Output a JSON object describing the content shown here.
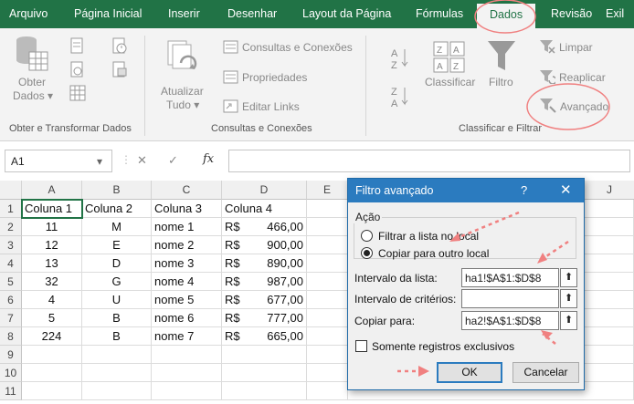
{
  "ribbon_tabs": [
    "Arquivo",
    "Página Inicial",
    "Inserir",
    "Desenhar",
    "Layout da Página",
    "Fórmulas",
    "Dados",
    "Revisão",
    "Exil"
  ],
  "active_tab": "Dados",
  "groups": {
    "obter": {
      "label": "Obter e Transformar Dados",
      "obter_btn_line1": "Obter",
      "obter_btn_line2": "Dados"
    },
    "consultas": {
      "label": "Consultas e Conexões",
      "atualizar_line1": "Atualizar",
      "atualizar_line2": "Tudo",
      "consultas_conexoes": "Consultas e Conexões",
      "propriedades": "Propriedades",
      "editar_links": "Editar Links"
    },
    "classificar": {
      "label": "Classificar e Filtrar",
      "classificar": "Classificar",
      "filtro": "Filtro",
      "limpar": "Limpar",
      "reaplicar": "Reaplicar",
      "avancado": "Avançado"
    }
  },
  "formula_bar": {
    "name_box": "A1",
    "fx": "fx",
    "cancel_glyph": "✕",
    "enter_glyph": "✓"
  },
  "columns": [
    "A",
    "B",
    "C",
    "D",
    "E",
    "J"
  ],
  "rows": [
    "1",
    "2",
    "3",
    "4",
    "5",
    "6",
    "7",
    "8",
    "9",
    "10",
    "11"
  ],
  "table": {
    "headers": [
      "Coluna 1",
      "Coluna 2",
      "Coluna 3",
      "Coluna 4"
    ],
    "currency": "R$",
    "data": [
      [
        "11",
        "M",
        "nome 1",
        "466,00"
      ],
      [
        "12",
        "E",
        "nome 2",
        "900,00"
      ],
      [
        "13",
        "D",
        "nome 3",
        "890,00"
      ],
      [
        "32",
        "G",
        "nome 4",
        "987,00"
      ],
      [
        "4",
        "U",
        "nome 5",
        "677,00"
      ],
      [
        "5",
        "B",
        "nome 6",
        "777,00"
      ],
      [
        "224",
        "B",
        "nome 7",
        "665,00"
      ]
    ]
  },
  "dialog": {
    "title": "Filtro avançado",
    "help": "?",
    "close": "✕",
    "acao_label": "Ação",
    "radio_filtrar": "Filtrar a lista no local",
    "radio_copiar": "Copiar para outro local",
    "selected": "copiar",
    "intervalo_lista_label": "Intervalo da lista:",
    "intervalo_lista_value": "ha1!$A$1:$D$8",
    "intervalo_criterios_label": "Intervalo de critérios:",
    "intervalo_criterios_value": "",
    "copiar_para_label": "Copiar para:",
    "copiar_para_value": "ha2!$A$1:$D$8",
    "somente_label": "Somente registros exclusivos",
    "somente_checked": false,
    "ok": "OK",
    "cancelar": "Cancelar"
  },
  "colors": {
    "excel_green": "#217346",
    "dialog_blue": "#2b7bbf",
    "annotation": "#f08080"
  }
}
